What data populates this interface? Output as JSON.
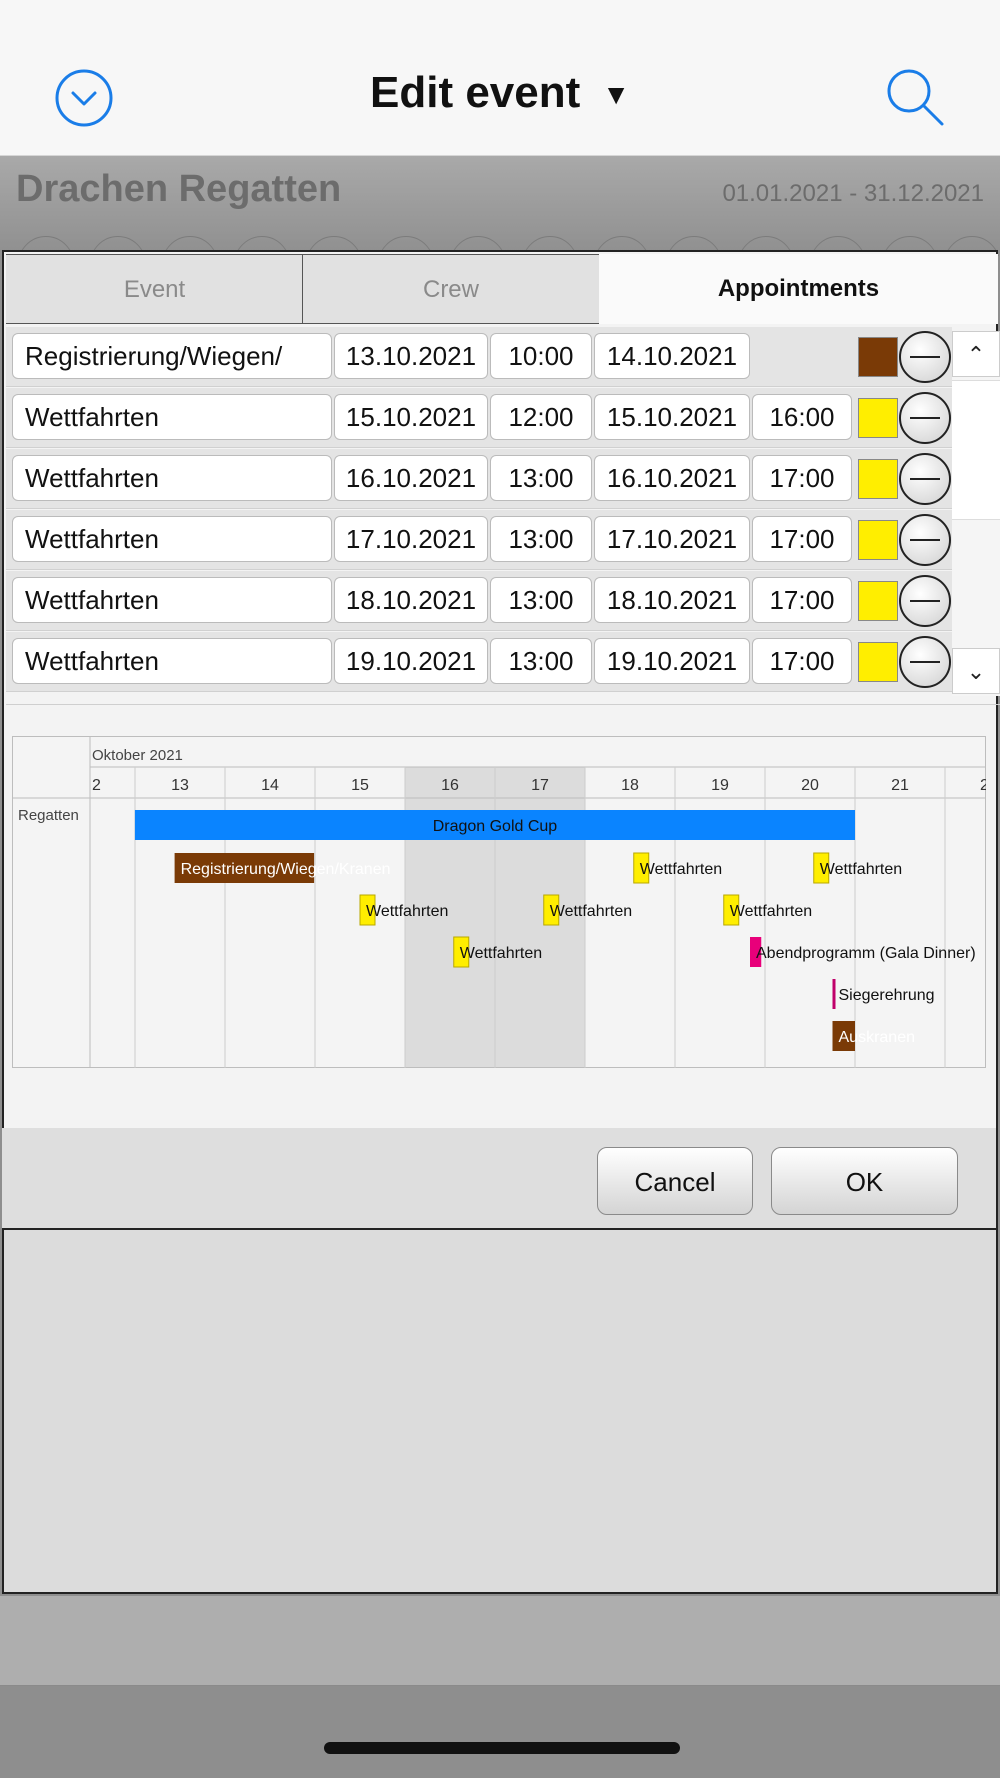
{
  "nav": {
    "title": "Edit event",
    "back_icon": "chevron-down-circle-icon",
    "search_icon": "search-icon",
    "accent": "#1a7de8"
  },
  "event": {
    "name": "Drachen Regatten",
    "dates": "01.01.2021 - 31.12.2021"
  },
  "tabs": [
    {
      "label": "Event",
      "active": false
    },
    {
      "label": "Crew",
      "active": false
    },
    {
      "label": "Appointments",
      "active": true
    }
  ],
  "appointments": [
    {
      "name": "Registrierung/Wiegen/",
      "start_date": "13.10.2021",
      "start_time": "10:00",
      "end_date": "14.10.2021",
      "end_time": "",
      "color": "#7a3a06"
    },
    {
      "name": "Wettfahrten",
      "start_date": "15.10.2021",
      "start_time": "12:00",
      "end_date": "15.10.2021",
      "end_time": "16:00",
      "color": "#ffee00"
    },
    {
      "name": "Wettfahrten",
      "start_date": "16.10.2021",
      "start_time": "13:00",
      "end_date": "16.10.2021",
      "end_time": "17:00",
      "color": "#ffee00"
    },
    {
      "name": "Wettfahrten",
      "start_date": "17.10.2021",
      "start_time": "13:00",
      "end_date": "17.10.2021",
      "end_time": "17:00",
      "color": "#ffee00"
    },
    {
      "name": "Wettfahrten",
      "start_date": "18.10.2021",
      "start_time": "13:00",
      "end_date": "18.10.2021",
      "end_time": "17:00",
      "color": "#ffee00"
    },
    {
      "name": "Wettfahrten",
      "start_date": "19.10.2021",
      "start_time": "13:00",
      "end_date": "19.10.2021",
      "end_time": "17:00",
      "color": "#ffee00"
    }
  ],
  "scroll": {
    "up_icon": "chevron-up-icon",
    "down_icon": "chevron-down-icon"
  },
  "timeline": {
    "month_label": "Oktober 2021",
    "row_label": "Regatten",
    "days": [
      "2",
      "13",
      "14",
      "15",
      "16",
      "17",
      "18",
      "19",
      "20",
      "21",
      "2"
    ],
    "weekend_days": [
      "16",
      "17"
    ],
    "bars": [
      {
        "label": "Dragon Gold Cup",
        "start": "12.10.2021 24:00",
        "end": "21.10.2021",
        "color": "#0a84ff"
      },
      {
        "label": "Registrierung/Wiegen/Kranen",
        "start": "13.10.2021 10:00",
        "end": "14.10.2021",
        "color": "#7a3a06"
      },
      {
        "label": "Wettfahrten",
        "start": "15.10.2021 12:00",
        "end": "15.10.2021 16:00",
        "color": "#ffee00"
      },
      {
        "label": "Wettfahrten",
        "start": "16.10.2021 13:00",
        "end": "16.10.2021 17:00",
        "color": "#ffee00"
      },
      {
        "label": "Wettfahrten",
        "start": "17.10.2021 13:00",
        "end": "17.10.2021 17:00",
        "color": "#ffee00"
      },
      {
        "label": "Wettfahrten",
        "start": "18.10.2021 13:00",
        "end": "18.10.2021 17:00",
        "color": "#ffee00"
      },
      {
        "label": "Wettfahrten",
        "start": "19.10.2021 13:00",
        "end": "19.10.2021 17:00",
        "color": "#ffee00"
      },
      {
        "label": "Wettfahrten",
        "start": "20.10.2021 13:00",
        "end": "20.10.2021 17:00",
        "color": "#ffee00"
      },
      {
        "label": "Abendprogramm (Gala Dinner)",
        "start": "19.10.2021 20:00",
        "end": "19.10.2021 23:00",
        "color": "#e8007a"
      },
      {
        "label": "Siegerehrung",
        "start": "20.10.2021 18:00",
        "end": "20.10.2021 18:30",
        "color": "#c0006a"
      },
      {
        "label": "Auskranen",
        "start": "20.10.2021 18:00",
        "end": "21.10.2021",
        "color": "#7a3a06"
      }
    ]
  },
  "buttons": {
    "cancel": "Cancel",
    "ok": "OK"
  }
}
